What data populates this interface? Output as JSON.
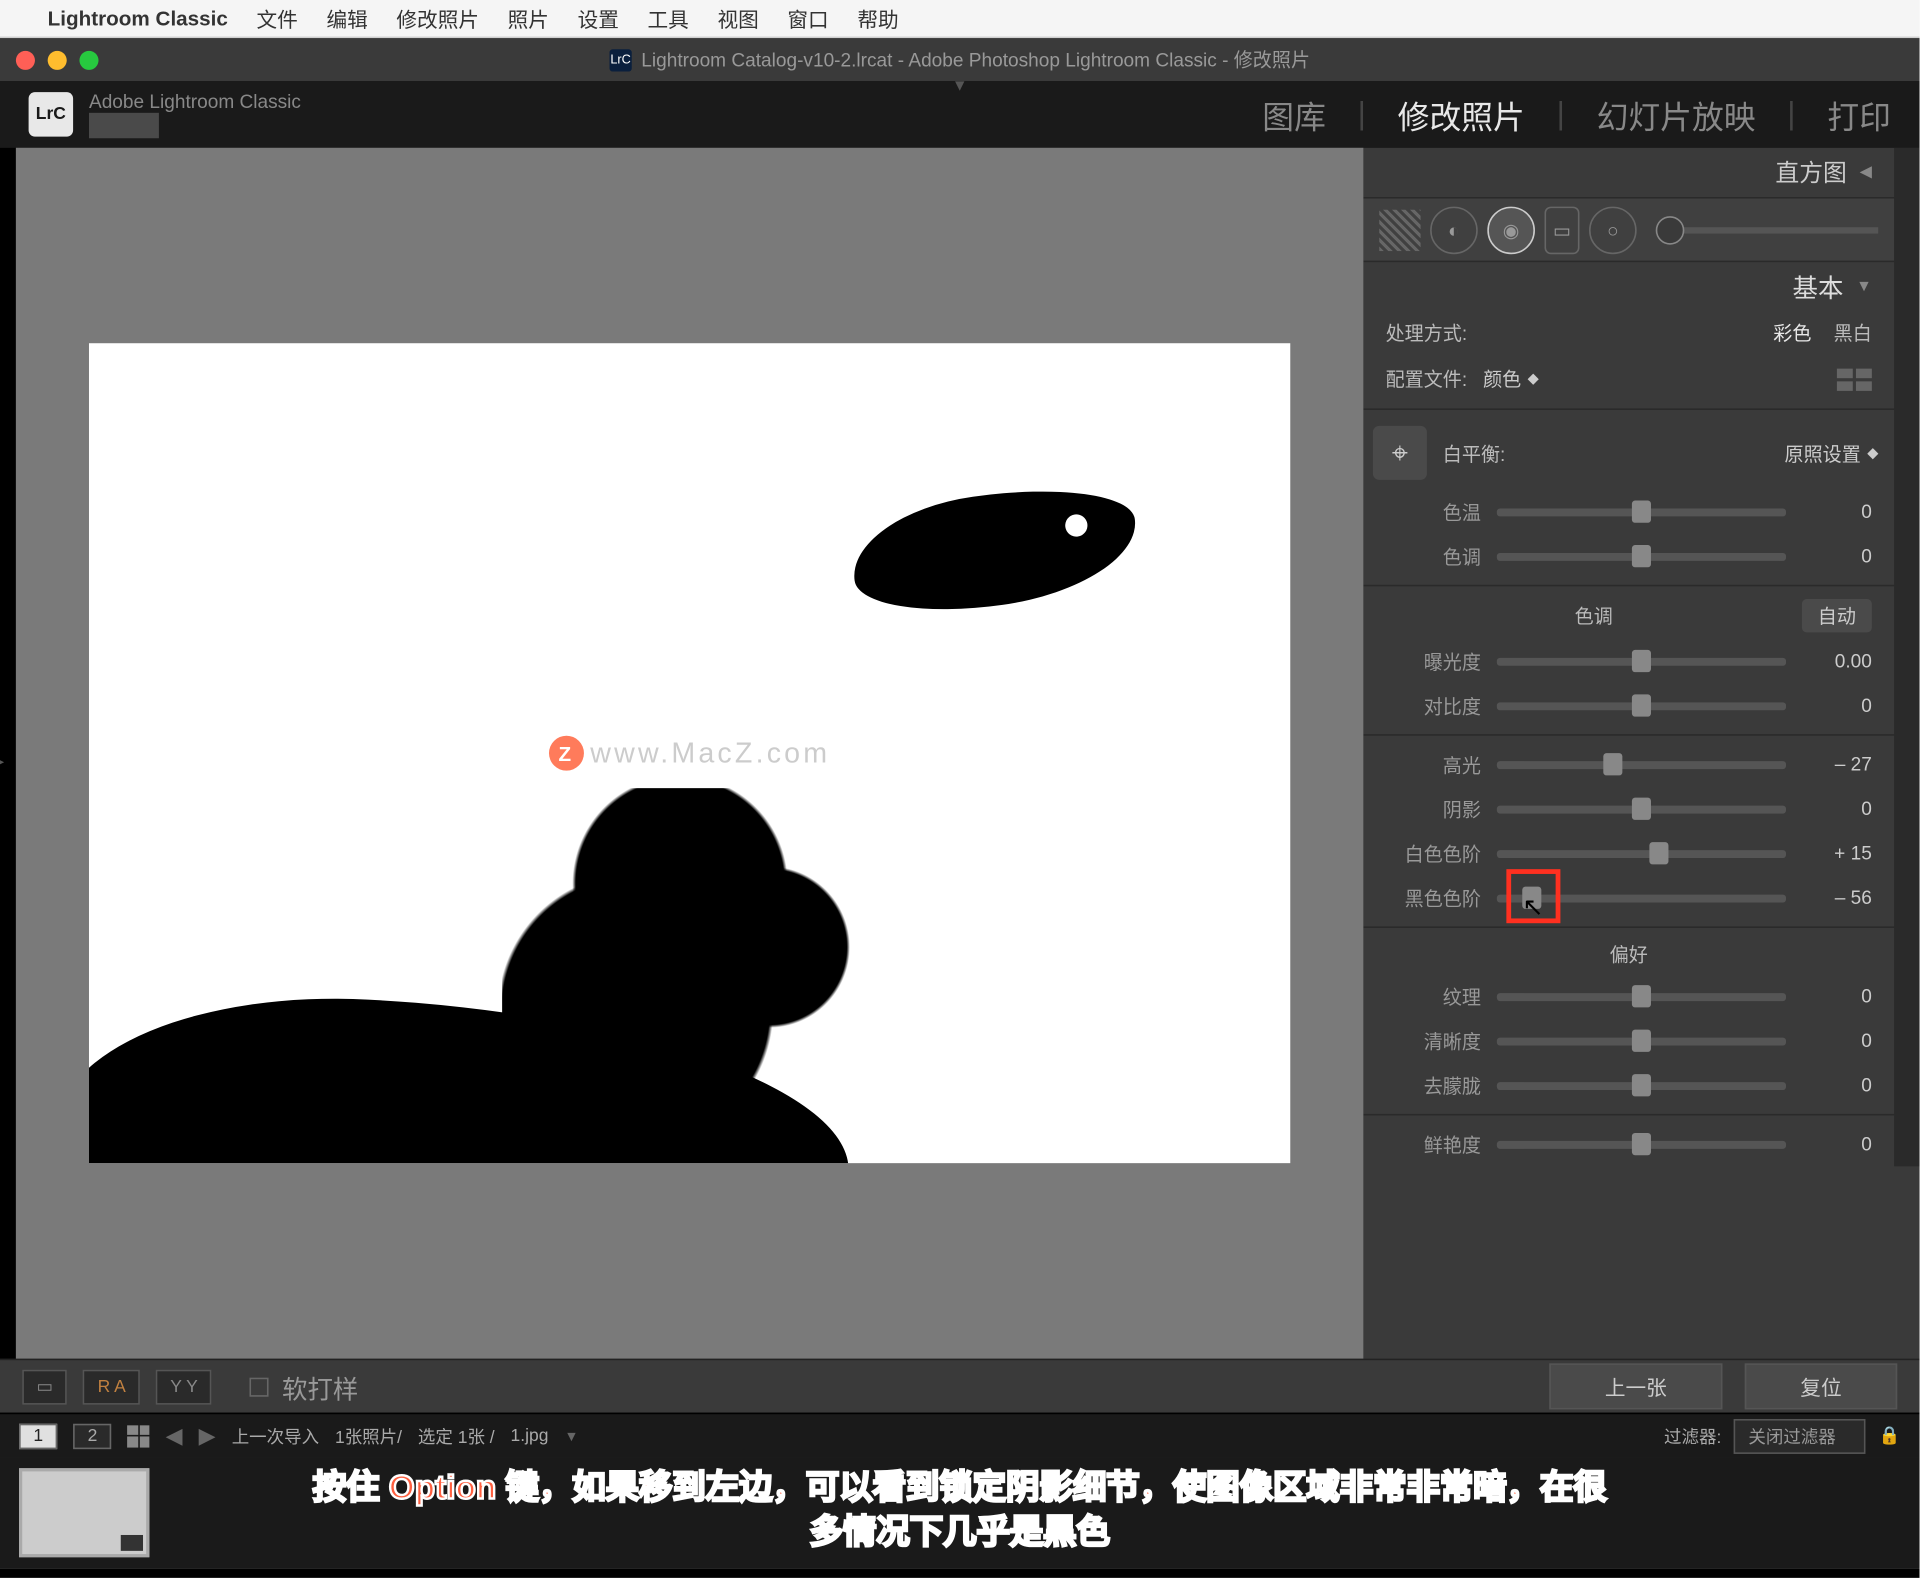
{
  "menubar": {
    "app": "Lightroom Classic",
    "items": [
      "文件",
      "编辑",
      "修改照片",
      "照片",
      "设置",
      "工具",
      "视图",
      "窗口",
      "帮助"
    ]
  },
  "titlebar": {
    "title": "Lightroom Catalog-v10-2.lrcat - Adobe Photoshop Lightroom Classic - 修改照片",
    "badge": "LrC"
  },
  "header": {
    "brand": "Adobe Lightroom Classic",
    "badge": "LrC",
    "modules": [
      "图库",
      "修改照片",
      "幻灯片放映",
      "打印"
    ],
    "active_module": "修改照片"
  },
  "watermark": "www.MacZ.com",
  "panel": {
    "histogram": "直方图",
    "basic": "基本",
    "treatment": {
      "label": "处理方式:",
      "color": "彩色",
      "bw": "黑白"
    },
    "profile": {
      "label": "配置文件:",
      "value": "颜色"
    },
    "wb": {
      "label": "白平衡:",
      "value": "原照设置"
    },
    "temp": {
      "label": "色温",
      "value": "0",
      "pos": 50
    },
    "tint": {
      "label": "色调",
      "value": "0",
      "pos": 50
    },
    "tone": {
      "label": "色调",
      "auto": "自动"
    },
    "exposure": {
      "label": "曝光度",
      "value": "0.00",
      "pos": 50
    },
    "contrast": {
      "label": "对比度",
      "value": "0",
      "pos": 50
    },
    "highlights": {
      "label": "高光",
      "value": "– 27",
      "pos": 40
    },
    "shadows": {
      "label": "阴影",
      "value": "0",
      "pos": 50
    },
    "whites": {
      "label": "白色色阶",
      "value": "+ 15",
      "pos": 56
    },
    "blacks": {
      "label": "黑色色阶",
      "value": "– 56",
      "pos": 12
    },
    "presence": {
      "label": "偏好"
    },
    "texture": {
      "label": "纹理",
      "value": "0",
      "pos": 50
    },
    "clarity": {
      "label": "清晰度",
      "value": "0",
      "pos": 50
    },
    "dehaze": {
      "label": "去朦胧",
      "value": "0",
      "pos": 50
    },
    "vibrance": {
      "label": "鲜艳度",
      "value": "0",
      "pos": 50
    }
  },
  "bottom": {
    "softproof": "软打样",
    "prev": "上一张",
    "reset": "复位"
  },
  "filmstrip": {
    "source": "上一次导入",
    "count": "1张照片/",
    "selected": "选定 1张 /",
    "filename": "1.jpg",
    "filter_label": "过滤器:",
    "filter_value": "关闭过滤器"
  },
  "annotation": {
    "line1": "按住 Option 键，如果移到左边，可以看到锁定阴影细节，使图像区域非常非常暗，在很",
    "line2": "多情况下几乎是黑色"
  }
}
